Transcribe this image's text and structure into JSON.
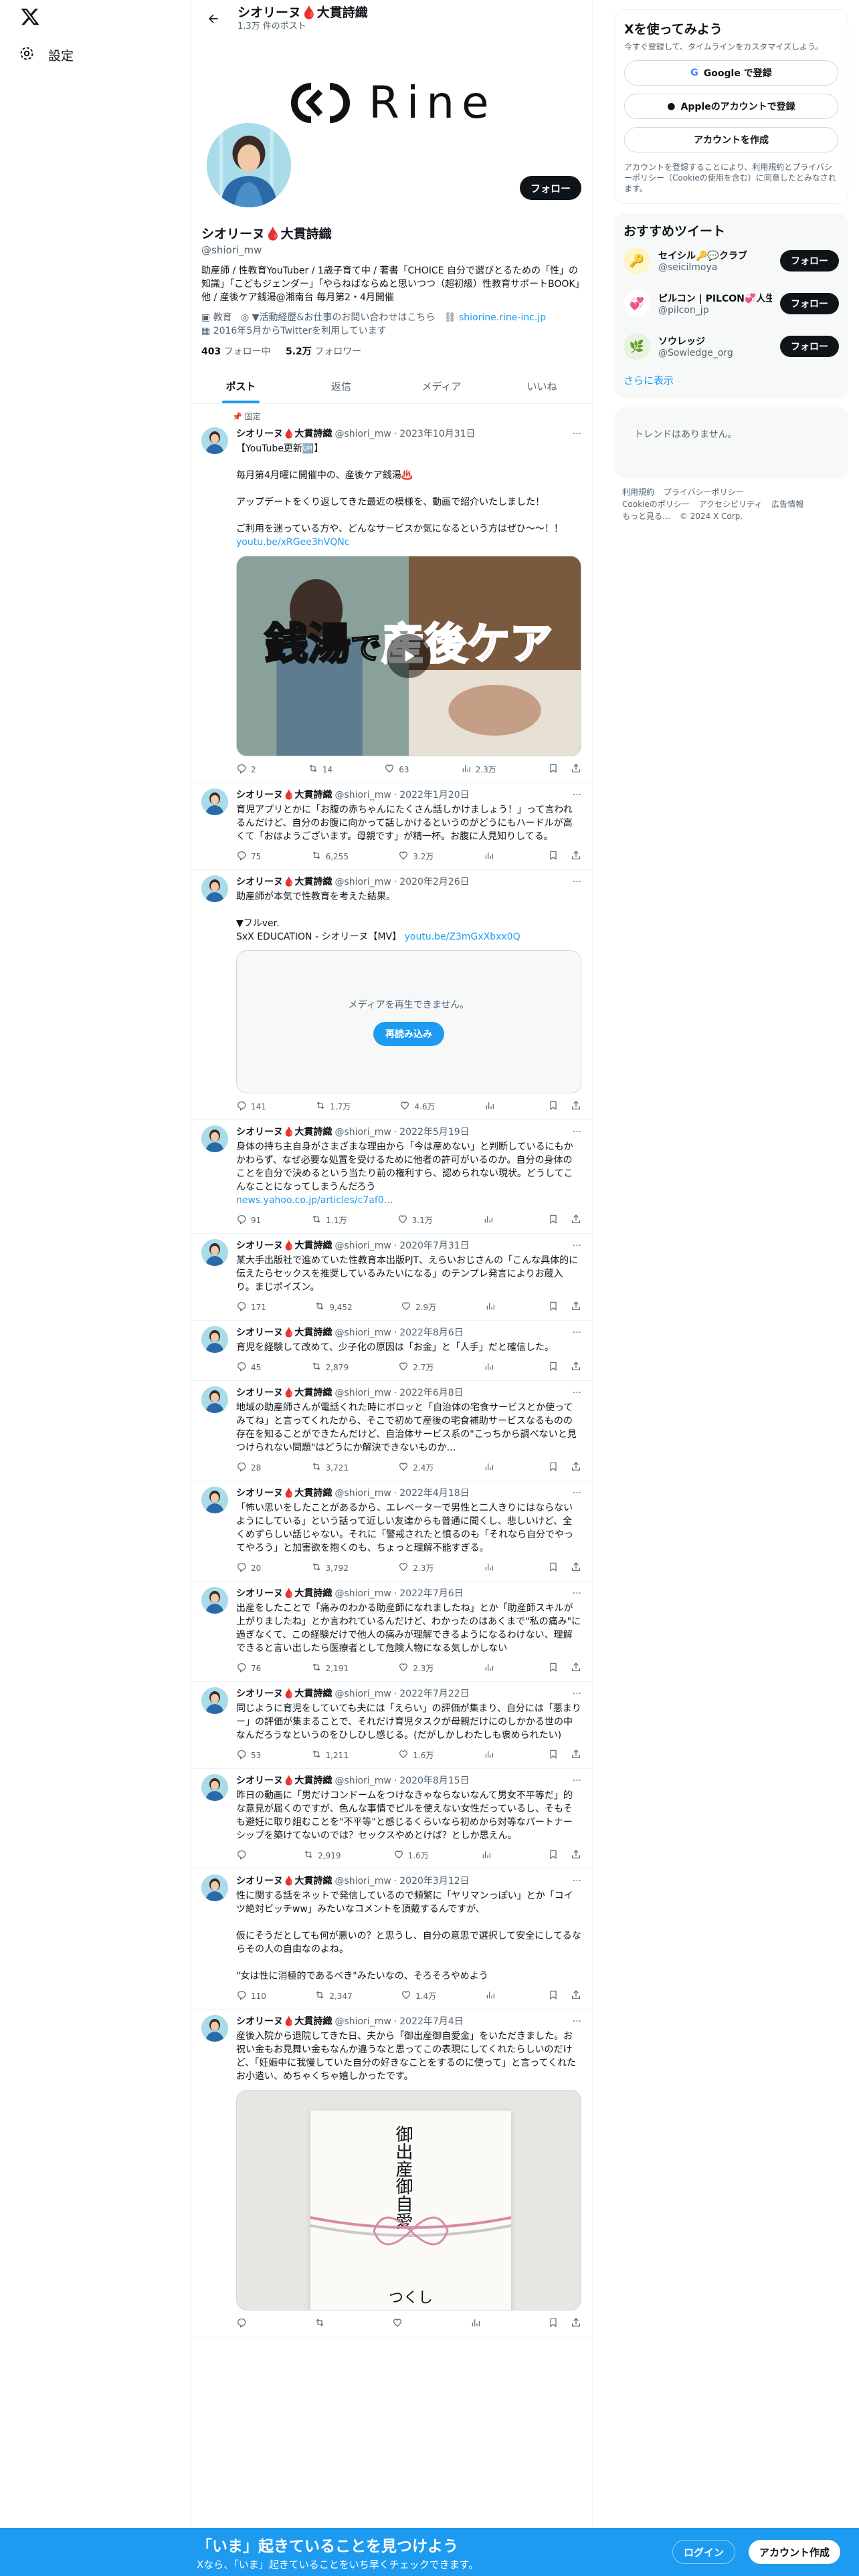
{
  "left": {
    "settings_label": "設定"
  },
  "header": {
    "name": "シオリーヌ🩸大貫詩織",
    "post_count": "1.3万 件のポスト"
  },
  "banner": {
    "logo_text": "Rine"
  },
  "profile": {
    "name": "シオリーヌ🩸大貫詩織",
    "handle": "@shiori_mw",
    "follow_label": "フォロー",
    "bio": "助産師 / 性教育YouTuber / 1歳子育て中 / 著書「CHOICE 自分で選びとるための「性」の知識」「こどもジェンダー」「やらねばならぬと思いつつ（超初級）性教育サポートBOOK」他 / 産後ケア銭湯@湘南台 毎月第2・4月開催",
    "category": "教育",
    "location": "▼活動経歴&お仕事のお問い合わせはこちら",
    "website": "shiorine.rine-inc.jp",
    "joined": "2016年5月からTwitterを利用しています",
    "following_count": "403",
    "following_label": "フォロー中",
    "followers_count": "5.2万",
    "followers_label": "フォロワー"
  },
  "tabs": [
    "ポスト",
    "返信",
    "メディア",
    "いいね"
  ],
  "pinned_label": "固定",
  "tweets": [
    {
      "name": "シオリーヌ🩸大貫詩織",
      "handle": "@shiori_mw",
      "date": "2023年10月31日",
      "text": "【YouTube更新🆙】\n\n毎月第4月曜に開催中の、産後ケア銭湯♨️\n\nアップデートをくり返してきた最近の模様を、動画で紹介いたしました！\n\nご利用を迷っている方や、どんなサービスか気になるという方はぜひ〜〜！！\n",
      "link": "youtu.be/xRGee3hVQNc",
      "media_text_1": "銭湯",
      "media_text_2": "で",
      "media_text_3": "産後ケア",
      "replies": "2",
      "retweets": "14",
      "likes": "63",
      "views": "2.3万"
    },
    {
      "name": "シオリーヌ🩸大貫詩織",
      "handle": "@shiori_mw",
      "date": "2022年1月20日",
      "text": "育児アプリとかに「お腹の赤ちゃんにたくさん話しかけましょう！」って言われるんだけど、自分のお腹に向かって話しかけるというのがどうにもハードルが高くて「おはようございます。母親です」が精一杯。お腹に人見知りしてる。",
      "replies": "75",
      "retweets": "6,255",
      "likes": "3.2万",
      "views": ""
    },
    {
      "name": "シオリーヌ🩸大貫詩織",
      "handle": "@shiori_mw",
      "date": "2020年2月26日",
      "text": "助産師が本気で性教育を考えた結果。\n\n▼フルver.\nSxX EDUCATION - シオリーヌ【MV】 ",
      "link": "youtu.be/Z3mGxXbxx0Q",
      "media_error": "メディアを再生できません。",
      "reload_label": "再読み込み",
      "replies": "141",
      "retweets": "1.7万",
      "likes": "4.6万",
      "views": ""
    },
    {
      "name": "シオリーヌ🩸大貫詩織",
      "handle": "@shiori_mw",
      "date": "2022年5月19日",
      "text": "身体の持ち主自身がさまざまな理由から「今は産めない」と判断しているにもかかわらず、なぜ必要な処置を受けるために他者の許可がいるのか。自分の身体のことを自分で決めるという当たり前の権利すら、認められない現状。どうしてこんなことになってしまうんだろう",
      "link": "news.yahoo.co.jp/articles/c7af0…",
      "replies": "91",
      "retweets": "1.1万",
      "likes": "3.1万",
      "views": ""
    },
    {
      "name": "シオリーヌ🩸大貫詩織",
      "handle": "@shiori_mw",
      "date": "2020年7月31日",
      "text": "某大手出版社で進めていた性教育本出版PJT、えらいおじさんの「こんな具体的に伝えたらセックスを推奨しているみたいになる」のテンプレ発言によりお蔵入り。まじポイズン。",
      "replies": "171",
      "retweets": "9,452",
      "likes": "2.9万",
      "views": ""
    },
    {
      "name": "シオリーヌ🩸大貫詩織",
      "handle": "@shiori_mw",
      "date": "2022年8月6日",
      "text": "育児を経験して改めて、少子化の原因は「お金」と「人手」だと確信した。",
      "replies": "45",
      "retweets": "2,879",
      "likes": "2.7万",
      "views": ""
    },
    {
      "name": "シオリーヌ🩸大貫詩織",
      "handle": "@shiori_mw",
      "date": "2022年6月8日",
      "text": "地域の助産師さんが電話くれた時にボロッと「自治体の宅食サービスとか使ってみてね」と言ってくれたから、そこで初めて産後の宅食補助サービスなるものの存在を知ることができたんだけど、自治体サービス系の\"こっちから調べないと見つけられない問題\"はどうにか解決できないものか…",
      "replies": "28",
      "retweets": "3,721",
      "likes": "2.4万",
      "views": ""
    },
    {
      "name": "シオリーヌ🩸大貫詩織",
      "handle": "@shiori_mw",
      "date": "2022年4月18日",
      "text": "「怖い思いをしたことがあるから、エレベーターで男性と二人きりにはならないようにしている」という話って近しい友達からも普通に聞くし、悲しいけど、全くめずらしい話じゃない。それに「警戒されたと憤るのも「それなら自分でやってやろう」と加害欲を抱くのも、ちょっと理解不能すぎる。",
      "replies": "20",
      "retweets": "3,792",
      "likes": "2.3万",
      "views": ""
    },
    {
      "name": "シオリーヌ🩸大貫詩織",
      "handle": "@shiori_mw",
      "date": "2022年7月6日",
      "text": "出産をしたことで「痛みのわかる助産師になれましたね」とか「助産師スキルが上がりましたね」とか言われているんだけど、わかったのはあくまで\"私の痛み\"に過ぎなくて、この経験だけで他人の痛みが理解できるようになるわけない、理解できると言い出したら医療者として危険人物になる気しかしない",
      "replies": "76",
      "retweets": "2,191",
      "likes": "2.3万",
      "views": ""
    },
    {
      "name": "シオリーヌ🩸大貫詩織",
      "handle": "@shiori_mw",
      "date": "2022年7月22日",
      "text": "同じように育児をしていても夫には「えらい」の評価が集まり、自分には「悪まりー」の評価が集まることで、それだけ育児タスクが母親だけにのしかかる世の中なんだろうなというのをひしひし感じる。(だがしかしわたしも褒められたい)",
      "replies": "53",
      "retweets": "1,211",
      "likes": "1.6万",
      "views": ""
    },
    {
      "name": "シオリーヌ🩸大貫詩織",
      "handle": "@shiori_mw",
      "date": "2020年8月15日",
      "text": "昨日の動画に「男だけコンドームをつけなきゃならないなんて男女不平等だ」的な意見が届くのですが、色んな事情でピルを使えない女性だっているし、そもそも避妊に取り組むことを\"不平等\"と感じるくらいなら初めから対等なパートナーシップを築けてないのでは？セックスやめとけば？としか思えん。",
      "replies": "",
      "retweets": "2,919",
      "likes": "1.6万",
      "views": ""
    },
    {
      "name": "シオリーヌ🩸大貫詩織",
      "handle": "@shiori_mw",
      "date": "2020年3月12日",
      "text": "性に関する話をネットで発信しているので頻繁に「ヤリマンっぽい」とか「コイツ絶対ビッチww」みたいなコメントを頂戴するんですが、\n\n仮にそうだとしても何が悪いの？と思うし、自分の意思で選択して安全にしてるならその人の自由なのよね。\n\n\"女は性に消極的であるべき\"みたいなの、そろそろやめよう",
      "replies": "110",
      "retweets": "2,347",
      "likes": "1.4万",
      "views": ""
    },
    {
      "name": "シオリーヌ🩸大貫詩織",
      "handle": "@shiori_mw",
      "date": "2022年7月4日",
      "text": "産後入院から退院してきた日、夫から「御出産御自愛金」をいただきました。お祝い金もお見舞い金もなんか違うなと思ってこの表現にしてくれたらしいのだけど、「妊娠中に我慢していた自分の好きなことをするのに使って」と言ってくれたお小遣い、めちゃくちゃ嬉しかったです。",
      "envelope_title": "御出産御自愛",
      "envelope_sign": "つくし",
      "replies": "",
      "retweets": "",
      "likes": "",
      "views": ""
    }
  ],
  "right": {
    "join_title": "Xを使ってみよう",
    "join_sub": "今すぐ登録して、タイムラインをカスタマイズしよう。",
    "google_label": "Google で登録",
    "apple_label": "Appleのアカウントで登録",
    "create_label": "アカウントを作成",
    "terms": "アカウントを登録することにより、利用規約とプライバシーポリシー（Cookieの使用を含む）に同意したとみなされます。",
    "rec_title": "おすすめツイート",
    "recs": [
      {
        "name": "セイシル🔑💬クラブ",
        "handle": "@seicilmoya",
        "btn": "フォロー"
      },
      {
        "name": "ピルコン | PILCON💞人生",
        "handle": "@pilcon_jp",
        "btn": "フォロー"
      },
      {
        "name": "ソウレッジ",
        "handle": "@Sowledge_org",
        "btn": "フォロー"
      }
    ],
    "show_more": "さらに表示",
    "trends_empty": "トレンドはありません。",
    "footer": [
      "利用規約",
      "プライバシーポリシー",
      "Cookieのポリシー",
      "アクセシビリティ",
      "広告情報",
      "もっと見る…",
      "© 2024 X Corp."
    ]
  },
  "bottom": {
    "title": "「いま」起きていることを見つけよう",
    "sub": "Xなら、「いま」起きていることをいち早くチェックできます。",
    "login": "ログイン",
    "signup": "アカウント作成"
  },
  "colors": {
    "accent": "#1d9bf0",
    "text": "#0f1419",
    "muted": "#536471"
  }
}
